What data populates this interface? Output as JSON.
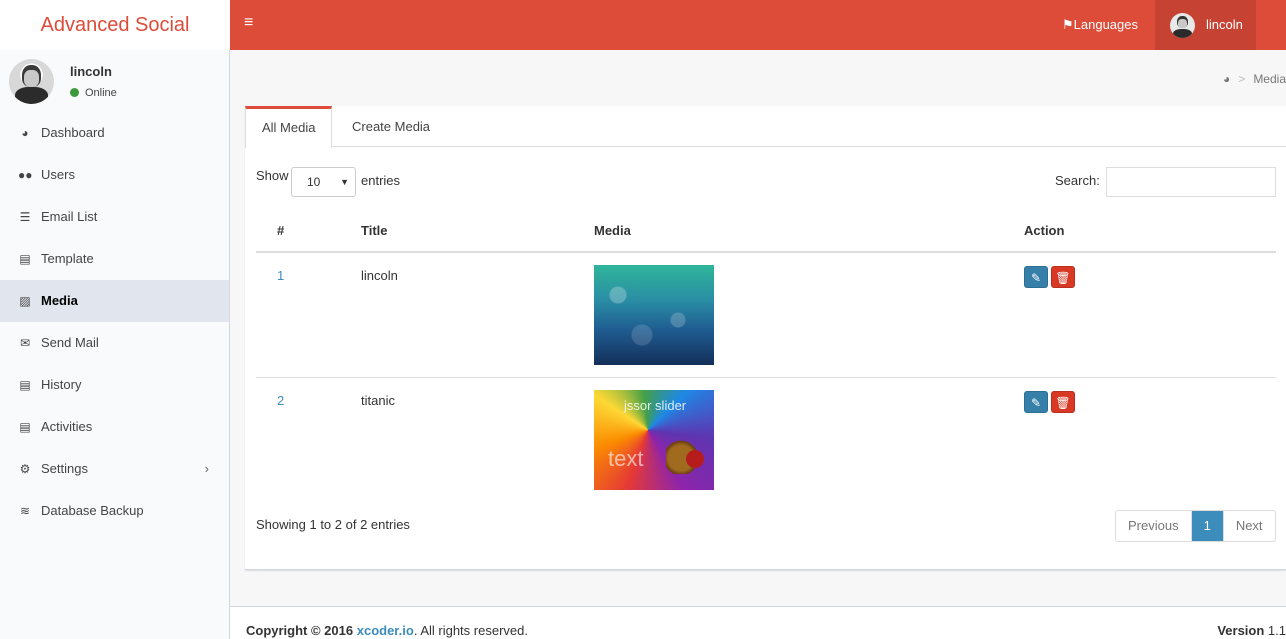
{
  "app": {
    "title": "Advanced Social"
  },
  "header": {
    "languages_label": "Languages",
    "user_name": "lincoln"
  },
  "sidebar": {
    "user": {
      "name": "lincoln",
      "status": "Online"
    },
    "items": [
      {
        "label": "Dashboard",
        "icon": "dashboard-icon"
      },
      {
        "label": "Users",
        "icon": "users-icon"
      },
      {
        "label": "Email List",
        "icon": "list-icon"
      },
      {
        "label": "Template",
        "icon": "template-icon"
      },
      {
        "label": "Media",
        "icon": "image-icon",
        "active": true
      },
      {
        "label": "Send Mail",
        "icon": "envelope-icon"
      },
      {
        "label": "History",
        "icon": "history-icon"
      },
      {
        "label": "Activities",
        "icon": "activities-icon"
      },
      {
        "label": "Settings",
        "icon": "gears-icon"
      },
      {
        "label": "Database Backup",
        "icon": "database-icon"
      }
    ]
  },
  "breadcrumb": {
    "current": "Media"
  },
  "tabs": {
    "all": "All Media",
    "create": "Create Media"
  },
  "table_controls": {
    "show": "Show",
    "page_size": "10",
    "entries": "entries",
    "search_label": "Search:"
  },
  "table": {
    "headers": [
      "#",
      "Title",
      "Media",
      "Action"
    ],
    "rows": [
      {
        "id": "1",
        "title": "lincoln"
      },
      {
        "id": "2",
        "title": "titanic",
        "thumb_text_top": "jssor slider",
        "thumb_text_bottom": "text"
      }
    ]
  },
  "pagination": {
    "info": "Showing 1 to 2 of 2 entries",
    "previous": "Previous",
    "current": "1",
    "next": "Next"
  },
  "footer": {
    "copyright_prefix": "Copyright © 2016",
    "link": "xcoder.io",
    "suffix": ". All rights reserved.",
    "version_label": "Version",
    "version": "1.1"
  },
  "colors": {
    "brand": "#dd4b39",
    "primary": "#3c8dbc",
    "danger": "#d73925"
  }
}
